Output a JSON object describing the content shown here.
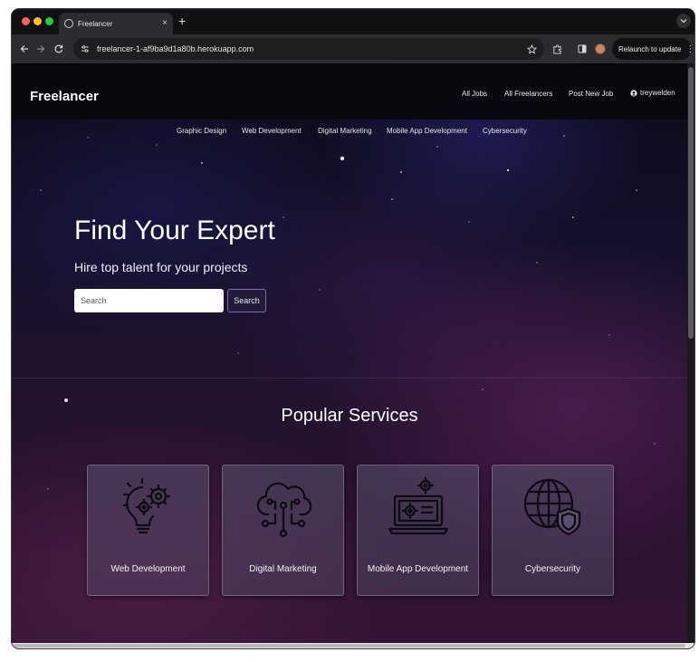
{
  "browser": {
    "tab_title": "Freelancer",
    "tab_close": "×",
    "new_tab": "+",
    "url": "freelancer-1-af9ba9d1a80b.herokuapp.com",
    "relaunch_label": "Relaunch to update",
    "relaunch_menu": "⋮"
  },
  "header": {
    "brand": "Freelancer",
    "nav": [
      "All Jobs",
      "All Freelancers",
      "Post New Job"
    ],
    "user": "treywelden"
  },
  "categories": [
    "Graphic Design",
    "Web Development",
    "Digital Marketing",
    "Mobile App Development",
    "Cybersecurity"
  ],
  "hero": {
    "title": "Find Your Expert",
    "subtitle": "Hire top talent for your projects",
    "search_placeholder": "Search",
    "search_button": "Search"
  },
  "services": {
    "title": "Popular Services",
    "cards": [
      {
        "label": "Web Development",
        "icon": "lightbulb-gear-icon"
      },
      {
        "label": "Digital Marketing",
        "icon": "cloud-circuit-icon"
      },
      {
        "label": "Mobile App Development",
        "icon": "laptop-gear-icon"
      },
      {
        "label": "Cybersecurity",
        "icon": "globe-shield-icon"
      }
    ]
  }
}
